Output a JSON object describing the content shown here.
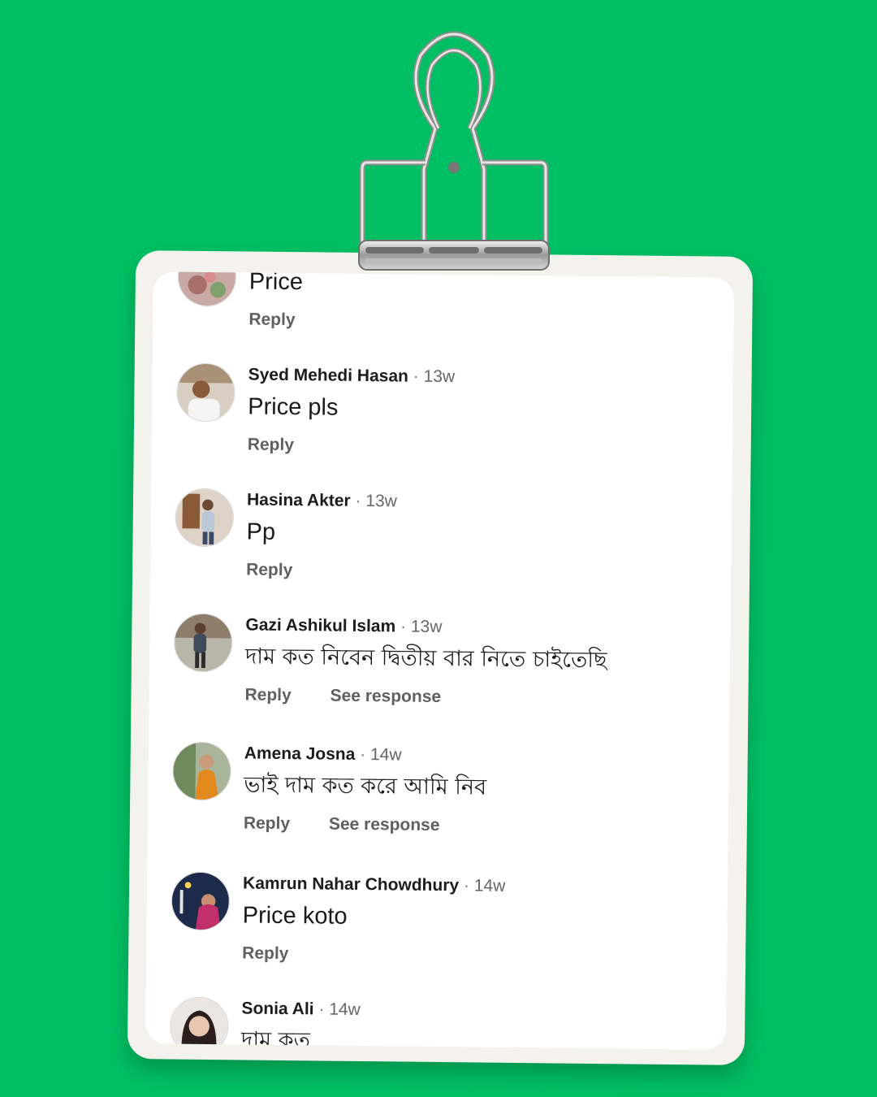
{
  "colors": {
    "background": "#00bf63",
    "card": "#ffffff",
    "paper": "#f4f2ec",
    "text": "#1a1a1a",
    "meta": "#666666"
  },
  "comments": [
    {
      "author": "",
      "time": "",
      "text": "Price",
      "reply_label": "Reply",
      "see_response_label": "",
      "avatar_icon": "avatar-icon"
    },
    {
      "author": "Syed Mehedi Hasan",
      "time": "13w",
      "text": "Price pls",
      "reply_label": "Reply",
      "see_response_label": "",
      "avatar_icon": "avatar-icon"
    },
    {
      "author": "Hasina Akter",
      "time": "13w",
      "text": "Pp",
      "reply_label": "Reply",
      "see_response_label": "",
      "avatar_icon": "avatar-icon"
    },
    {
      "author": "Gazi Ashikul Islam",
      "time": "13w",
      "text": "দাম কত নিবেন দ্বিতীয় বার  নিতে চাইতেছি",
      "reply_label": "Reply",
      "see_response_label": "See response",
      "avatar_icon": "avatar-icon"
    },
    {
      "author": "Amena Josna",
      "time": "14w",
      "text": "ভাই দাম কত করে আমি নিব",
      "reply_label": "Reply",
      "see_response_label": "See response",
      "avatar_icon": "avatar-icon"
    },
    {
      "author": "Kamrun Nahar Chowdhury",
      "time": "14w",
      "text": "Price koto",
      "reply_label": "Reply",
      "see_response_label": "",
      "avatar_icon": "avatar-icon"
    },
    {
      "author": "Sonia Ali",
      "time": "14w",
      "text": "দাম কত",
      "reply_label": "",
      "see_response_label": "",
      "avatar_icon": "avatar-icon"
    }
  ],
  "separator": "·"
}
